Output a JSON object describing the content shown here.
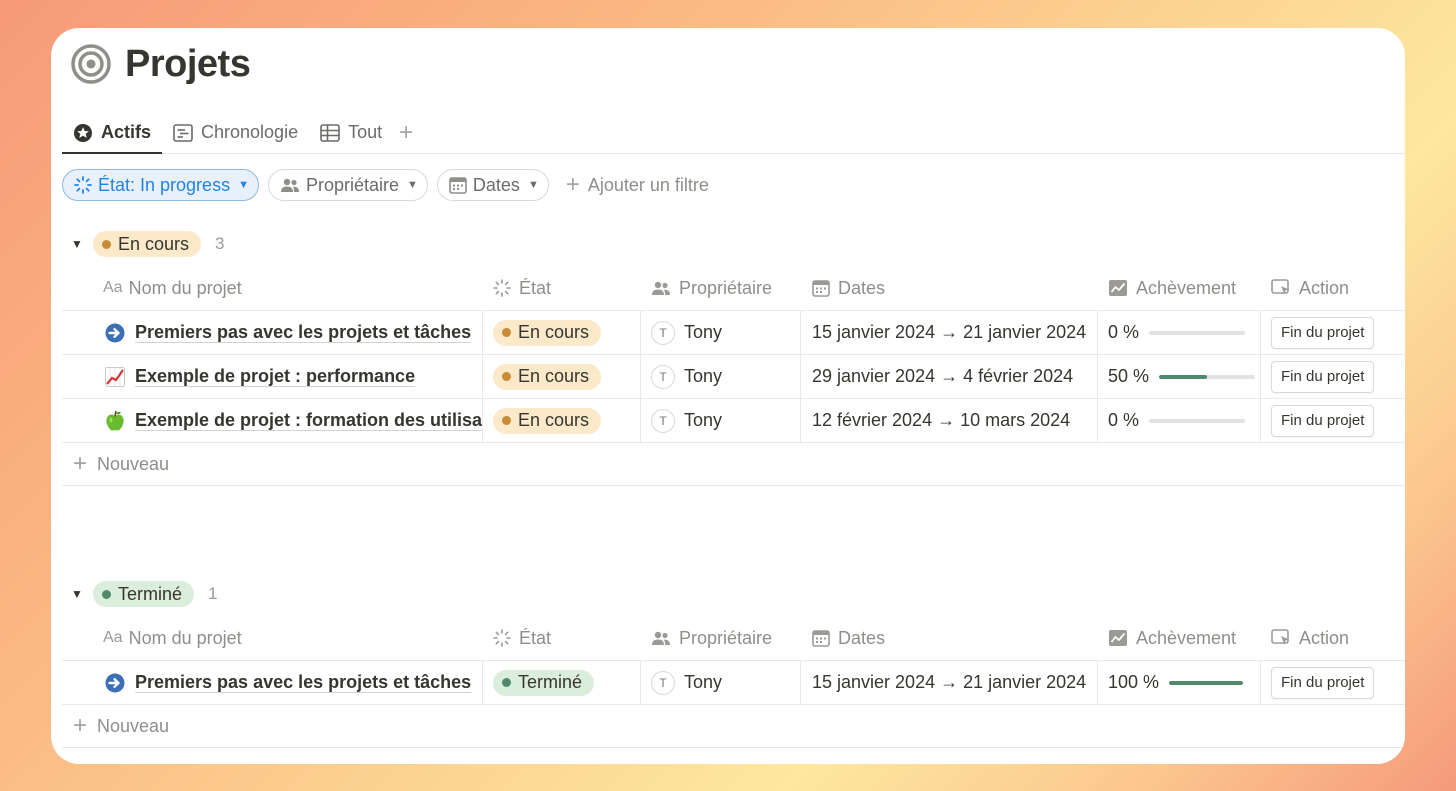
{
  "page": {
    "title": "Projets",
    "icon": "target-icon"
  },
  "tabs": [
    {
      "label": "Actifs",
      "icon": "star-circle-icon",
      "active": true
    },
    {
      "label": "Chronologie",
      "icon": "timeline-icon",
      "active": false
    },
    {
      "label": "Tout",
      "icon": "table-icon",
      "active": false
    }
  ],
  "filters": {
    "state": "État: In progress",
    "owner": "Propriétaire",
    "dates": "Dates",
    "add": "Ajouter un filtre"
  },
  "columns": {
    "name_prefix": "Aa",
    "name": "Nom du projet",
    "state": "État",
    "owner": "Propriétaire",
    "dates": "Dates",
    "completion": "Achèvement",
    "action": "Action"
  },
  "colors": {
    "in_progress_bg": "#fbe9c9",
    "in_progress_dot": "#c98b34",
    "done_bg": "#dbeddb",
    "done_dot": "#4f8a6b",
    "progress_fill": "#4f8a6b",
    "accent_blue": "#2383e2"
  },
  "groups": [
    {
      "label": "En cours",
      "count": "3",
      "rows": [
        {
          "emoji": "arrow-right-circle-icon",
          "name": "Premiers pas avec les projets et tâches",
          "state": "En cours",
          "owner_initial": "T",
          "owner": "Tony",
          "dates": "15 janvier 2024 → 21 janvier 2024",
          "completion_label": "0 %",
          "completion": 0,
          "action": "Fin du projet"
        },
        {
          "emoji": "chart-increasing-icon",
          "name": "Exemple de projet : performance",
          "state": "En cours",
          "owner_initial": "T",
          "owner": "Tony",
          "dates": "29 janvier 2024 → 4 février 2024",
          "completion_label": "50 %",
          "completion": 0.5,
          "action": "Fin du projet"
        },
        {
          "emoji": "green-apple-icon",
          "name": "Exemple de projet : formation des utilisateurs",
          "state": "En cours",
          "owner_initial": "T",
          "owner": "Tony",
          "dates": "12 février 2024 → 10 mars 2024",
          "completion_label": "0 %",
          "completion": 0,
          "action": "Fin du projet"
        }
      ],
      "new_label": "Nouveau"
    },
    {
      "label": "Terminé",
      "count": "1",
      "rows": [
        {
          "emoji": "arrow-right-circle-icon",
          "name": "Premiers pas avec les projets et tâches",
          "state": "Terminé",
          "owner_initial": "T",
          "owner": "Tony",
          "dates": "15 janvier 2024 → 21 janvier 2024",
          "completion_label": "100 %",
          "completion": 1,
          "action": "Fin du projet"
        }
      ],
      "new_label": "Nouveau"
    }
  ]
}
